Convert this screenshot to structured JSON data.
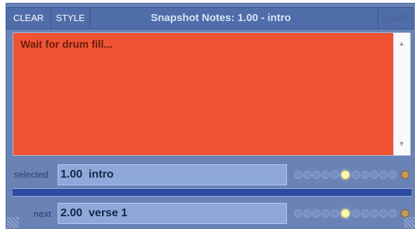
{
  "titlebar": {
    "clear_label": "CLEAR",
    "style_label": "STYLE",
    "title": "Snapshot Notes: 1.00 - intro",
    "right_label": "FLOAT"
  },
  "notes": {
    "text": "Wait for drum fill..."
  },
  "selected": {
    "label": "selected",
    "value": "1.00  intro"
  },
  "next": {
    "label": "next",
    "value": "2.00  verse 1"
  },
  "colors": {
    "notes_background": "#f05332",
    "panel": "#6a83b6",
    "titlebar": "#4f6da8"
  }
}
